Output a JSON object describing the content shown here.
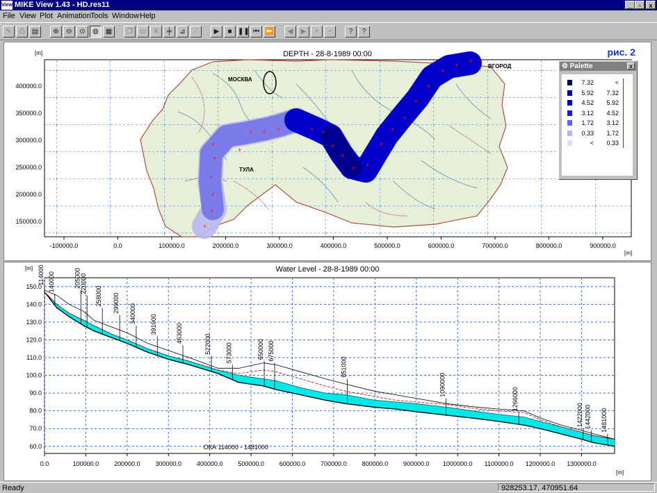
{
  "window": {
    "title": "MIKE View 1.43 - HD.res11",
    "app_icon_text": "View",
    "minimize_glyph": "_",
    "restore_glyph": "▫",
    "close_glyph": "x",
    "accent_color": "#000080"
  },
  "menu": [
    "File",
    "View",
    "Plot",
    "Animation",
    "Tools",
    "Window",
    "Help"
  ],
  "toolbar": {
    "buttons": [
      {
        "name": "print-preview-icon",
        "glyph": "✎",
        "disabled": true
      },
      {
        "name": "print-icon",
        "glyph": "⎙",
        "disabled": true
      },
      {
        "name": "save-icon",
        "glyph": "▤",
        "disabled": false
      },
      {
        "name": "zoom-in-icon",
        "glyph": "⊕",
        "disabled": false
      },
      {
        "name": "zoom-out-icon",
        "glyph": "⊖",
        "disabled": false
      },
      {
        "name": "zoom-extent-icon",
        "glyph": "⊙",
        "disabled": false
      },
      {
        "name": "palette-icon",
        "glyph": "◍",
        "disabled": false,
        "pressed": true
      },
      {
        "name": "table-icon",
        "glyph": "▦",
        "disabled": false
      },
      {
        "name": "copy-icon",
        "glyph": "❐",
        "disabled": true
      },
      {
        "name": "folder-icon",
        "glyph": "▭",
        "disabled": true
      },
      {
        "name": "legend-icon",
        "glyph": "≡",
        "disabled": true
      },
      {
        "name": "grid-icon",
        "glyph": "╪",
        "disabled": false
      },
      {
        "name": "chart-icon",
        "glyph": "⊿",
        "disabled": false
      },
      {
        "name": "profile-icon",
        "glyph": "⟋",
        "disabled": true
      },
      {
        "name": "play-icon",
        "glyph": "▶",
        "disabled": false
      },
      {
        "name": "stop-icon",
        "glyph": "■",
        "disabled": false
      },
      {
        "name": "pause-icon",
        "glyph": "❚❚",
        "disabled": false
      },
      {
        "name": "rewind-icon",
        "glyph": "⏮",
        "disabled": false
      },
      {
        "name": "fast-forward-icon",
        "glyph": "⏩",
        "disabled": false
      },
      {
        "name": "step-back-icon",
        "glyph": "◀",
        "disabled": true
      },
      {
        "name": "step-forward-icon",
        "glyph": "▶",
        "disabled": true
      },
      {
        "name": "plus-icon",
        "glyph": "+",
        "disabled": true
      },
      {
        "name": "minus-icon",
        "glyph": "−",
        "disabled": true
      },
      {
        "name": "help-icon",
        "glyph": "?",
        "disabled": false
      },
      {
        "name": "context-help-icon",
        "glyph": "?",
        "disabled": false
      }
    ]
  },
  "map_plot": {
    "title": "DEPTH - 28-8-1989 00:00",
    "unit_y": "[m]",
    "unit_x": "[m]",
    "annotation": "рис. 2",
    "map_labels": [
      "МОСКВА",
      "ТУЛА",
      "ВГОРОД"
    ],
    "y_ticks": [
      "400000.0",
      "350000.0",
      "300000.0",
      "250000.0",
      "200000.0",
      "150000.0"
    ],
    "x_ticks": [
      "-100000.0",
      "0.0",
      "100000.0",
      "200000.0",
      "300000.0",
      "400000.0",
      "500000.0",
      "600000.0",
      "700000.0",
      "800000.0",
      "900000.0"
    ]
  },
  "palette": {
    "title": "Palette",
    "close_glyph": "x",
    "rows": [
      {
        "color": "#000050",
        "low": "7.32",
        "high": "<"
      },
      {
        "color": "#000090",
        "low": "5.92",
        "high": "7.32"
      },
      {
        "color": "#0000c0",
        "low": "4.52",
        "high": "5.92"
      },
      {
        "color": "#1818e8",
        "low": "3.12",
        "high": "4.52"
      },
      {
        "color": "#6464e8",
        "low": "1.72",
        "high": "3.12"
      },
      {
        "color": "#b4b4ff",
        "low": "0.33",
        "high": "1.72"
      },
      {
        "color": "#dcdcff",
        "low": "<",
        "high": "0.33"
      }
    ]
  },
  "chart_data": {
    "type": "area",
    "title": "Water Level - 28-8-1989 00:00",
    "ylabel": "[m]",
    "xlabel": "[m]",
    "bottom_label": "ОКА  114000 - 1481000",
    "xlim": [
      0,
      1380000
    ],
    "ylim": [
      56,
      155
    ],
    "x_ticks": [
      "0.0",
      "100000.0",
      "200000.0",
      "300000.0",
      "400000.0",
      "500000.0",
      "600000.0",
      "700000.0",
      "800000.0",
      "900000.0",
      "1000000.0",
      "1100000.0",
      "1200000.0",
      "1300000.0"
    ],
    "y_ticks": [
      "150.0",
      "140.0",
      "130.0",
      "120.0",
      "110.0",
      "100.0",
      "90.0",
      "80.0",
      "70.0",
      "60.0"
    ],
    "grid": true,
    "colors": {
      "water": "#00e8e8",
      "bed": "#000000",
      "bank": "#000000",
      "dashed": "#c00000"
    },
    "x": [
      0,
      30000,
      60000,
      95000,
      120000,
      165000,
      200000,
      250000,
      300000,
      350000,
      420000,
      470000,
      530000,
      560000,
      620000,
      680000,
      730000,
      800000,
      850000,
      900000,
      975000,
      1050000,
      1100000,
      1160000,
      1200000,
      1250000,
      1300000,
      1330000,
      1380000
    ],
    "water_level": [
      147,
      140,
      135,
      131,
      128,
      123,
      120,
      115,
      111,
      108,
      103,
      100,
      98,
      97,
      93,
      90,
      89,
      86,
      85,
      84,
      82,
      79.5,
      78,
      76.5,
      74,
      71,
      68,
      66,
      64
    ],
    "bed_level": [
      147,
      138,
      133,
      128,
      125,
      121,
      118,
      113,
      109,
      106,
      101,
      96,
      94,
      92,
      89,
      86,
      84,
      82,
      81,
      79.5,
      77.5,
      75.5,
      74,
      72,
      70,
      67,
      64,
      62,
      60
    ],
    "bank_level": [
      148,
      145,
      140,
      136,
      131,
      127,
      124,
      118,
      114,
      110,
      104,
      104,
      107,
      106,
      102,
      98,
      95,
      91,
      89,
      87,
      84,
      82,
      81,
      80,
      76,
      72,
      69,
      67,
      64
    ],
    "dashed_level": [
      147,
      140,
      135,
      131,
      128,
      123,
      120,
      115,
      111,
      108,
      103,
      101,
      103,
      102,
      98,
      94,
      91,
      88,
      86,
      85,
      83.5,
      81,
      80,
      79,
      75,
      71,
      68,
      66,
      64
    ],
    "chainages": [
      {
        "label": "114000",
        "x": 0,
        "top": 150
      },
      {
        "label": "140000",
        "x": 25000,
        "top": 146
      },
      {
        "label": "205000",
        "x": 88000,
        "top": 148
      },
      {
        "label": "220000",
        "x": 103000,
        "top": 145
      },
      {
        "label": "258000",
        "x": 140000,
        "top": 138
      },
      {
        "label": "299000",
        "x": 182000,
        "top": 134
      },
      {
        "label": "340000",
        "x": 222000,
        "top": 128
      },
      {
        "label": "391000",
        "x": 273000,
        "top": 122
      },
      {
        "label": "453000",
        "x": 335000,
        "top": 117
      },
      {
        "label": "522000",
        "x": 404000,
        "top": 111
      },
      {
        "label": "573000",
        "x": 455000,
        "top": 106
      },
      {
        "label": "650000",
        "x": 532000,
        "top": 108
      },
      {
        "label": "675000",
        "x": 557000,
        "top": 107
      },
      {
        "label": "851000",
        "x": 733000,
        "top": 98
      },
      {
        "label": "1090000",
        "x": 972000,
        "top": 87
      },
      {
        "label": "1266000",
        "x": 1148000,
        "top": 79
      },
      {
        "label": "1422000",
        "x": 1304000,
        "top": 70
      },
      {
        "label": "1442000",
        "x": 1324000,
        "top": 69
      },
      {
        "label": "1481000",
        "x": 1363000,
        "top": 67
      }
    ]
  },
  "status": {
    "ready": "Ready",
    "coords": "928253.17, 470951.64"
  }
}
